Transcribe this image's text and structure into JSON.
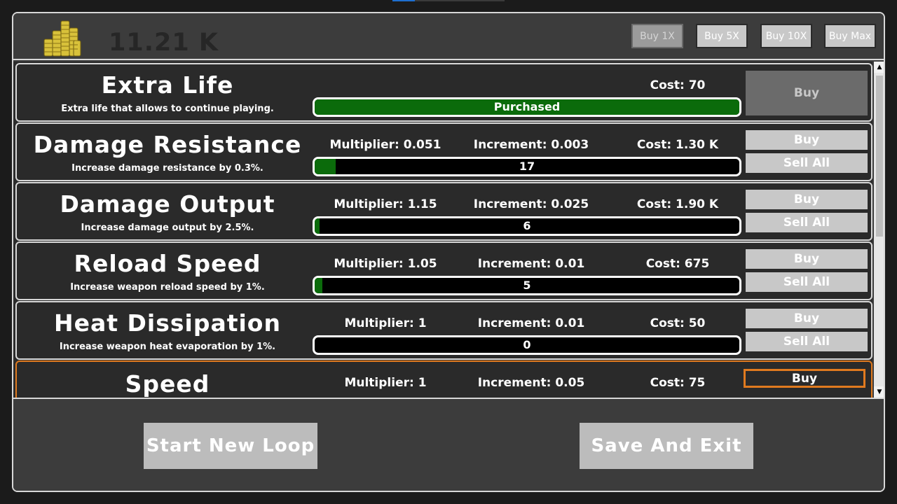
{
  "header": {
    "currency": "11.21 K",
    "buy_1x": "Buy 1X",
    "buy_5x": "Buy 5X",
    "buy_10x": "Buy 10X",
    "buy_max": "Buy Max"
  },
  "upgrades": [
    {
      "title": "Extra Life",
      "desc": "Extra life that allows to continue playing.",
      "cost": "Cost: 70",
      "bar_text": "Purchased",
      "progress": 1.0,
      "buy": "Buy"
    },
    {
      "title": "Damage Resistance",
      "desc": "Increase damage resistance by 0.3%.",
      "multiplier": "Multiplier: 0.051",
      "increment": "Increment: 0.003",
      "cost": "Cost: 1.30 K",
      "bar_text": "17",
      "progress": 0.05,
      "buy": "Buy",
      "sell": "Sell All"
    },
    {
      "title": "Damage Output",
      "desc": "Increase damage output by 2.5%.",
      "multiplier": "Multiplier: 1.15",
      "increment": "Increment: 0.025",
      "cost": "Cost: 1.90 K",
      "bar_text": "6",
      "progress": 0.012,
      "buy": "Buy",
      "sell": "Sell All"
    },
    {
      "title": "Reload Speed",
      "desc": "Increase weapon reload speed by 1%.",
      "multiplier": "Multiplier: 1.05",
      "increment": "Increment: 0.01",
      "cost": "Cost: 675",
      "bar_text": "5",
      "progress": 0.018,
      "buy": "Buy",
      "sell": "Sell All"
    },
    {
      "title": "Heat Dissipation",
      "desc": "Increase weapon heat evaporation by 1%.",
      "multiplier": "Multiplier: 1",
      "increment": "Increment: 0.01",
      "cost": "Cost: 50",
      "bar_text": "0",
      "progress": 0,
      "buy": "Buy",
      "sell": "Sell All"
    },
    {
      "title": "Speed",
      "multiplier": "Multiplier: 1",
      "increment": "Increment: 0.05",
      "cost": "Cost: 75",
      "buy": "Buy"
    }
  ],
  "footer": {
    "start_new_loop": "Start New Loop",
    "save_and_exit": "Save And Exit"
  },
  "colors": {
    "progress_fill": "#0b6b0b",
    "selected_outline": "#e07a1f"
  },
  "icons": {
    "currency": "gold-coin-stacks-icon",
    "scroll_up": "triangle-up-icon",
    "scroll_down": "triangle-down-icon"
  }
}
